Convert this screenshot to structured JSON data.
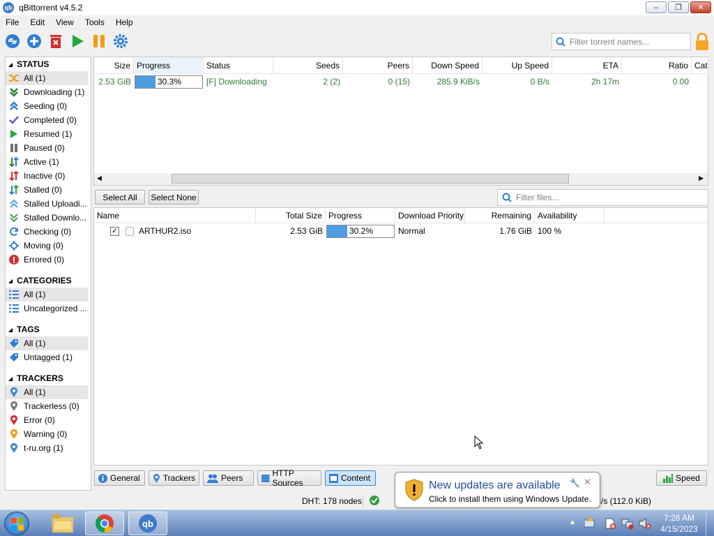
{
  "window": {
    "title": "qBittorrent v4.5.2",
    "app_icon_text": "qb"
  },
  "menu": [
    "File",
    "Edit",
    "View",
    "Tools",
    "Help"
  ],
  "toolbar": {
    "icons": [
      "add-link-icon",
      "add-torrent-icon",
      "delete-icon",
      "resume-icon",
      "pause-icon",
      "options-icon"
    ],
    "filter_placeholder": "Filter torrent names..."
  },
  "sidebar": {
    "status_title": "STATUS",
    "status": [
      {
        "label": "All (1)",
        "icon": "all-icon"
      },
      {
        "label": "Downloading (1)",
        "icon": "downloading-icon"
      },
      {
        "label": "Seeding (0)",
        "icon": "seeding-icon"
      },
      {
        "label": "Completed (0)",
        "icon": "completed-icon"
      },
      {
        "label": "Resumed (1)",
        "icon": "resumed-icon"
      },
      {
        "label": "Paused (0)",
        "icon": "paused-icon"
      },
      {
        "label": "Active (1)",
        "icon": "active-icon"
      },
      {
        "label": "Inactive (0)",
        "icon": "inactive-icon"
      },
      {
        "label": "Stalled (0)",
        "icon": "stalled-icon"
      },
      {
        "label": "Stalled Uploadi...",
        "icon": "stalled-uploading-icon"
      },
      {
        "label": "Stalled Downlo...",
        "icon": "stalled-downloading-icon"
      },
      {
        "label": "Checking (0)",
        "icon": "checking-icon"
      },
      {
        "label": "Moving (0)",
        "icon": "moving-icon"
      },
      {
        "label": "Errored (0)",
        "icon": "errored-icon"
      }
    ],
    "categories_title": "CATEGORIES",
    "categories": [
      {
        "label": "All (1)"
      },
      {
        "label": "Uncategorized ..."
      }
    ],
    "tags_title": "TAGS",
    "tags": [
      {
        "label": "All (1)"
      },
      {
        "label": "Untagged (1)"
      }
    ],
    "trackers_title": "TRACKERS",
    "trackers": [
      {
        "label": "All (1)",
        "color": "#3c8bd4"
      },
      {
        "label": "Trackerless (0)",
        "color": "#7a7a7a"
      },
      {
        "label": "Error (0)",
        "color": "#d32f2f"
      },
      {
        "label": "Warning (0)",
        "color": "#f39c12"
      },
      {
        "label": "t-ru.org (1)",
        "color": "#3c8bd4"
      }
    ]
  },
  "torrent_table": {
    "headers": [
      "Size",
      "Progress",
      "Status",
      "Seeds",
      "Peers",
      "Down Speed",
      "Up Speed",
      "ETA",
      "Ratio",
      "Cat"
    ],
    "rows": [
      {
        "size": "2.53 GiB",
        "progress_text": "30.3%",
        "progress": 0.303,
        "status": "[F] Downloading",
        "seeds": "2 (2)",
        "peers": "0 (15)",
        "down_speed": "285.9 KiB/s",
        "up_speed": "0 B/s",
        "eta": "2h 17m",
        "ratio": "0.00"
      }
    ]
  },
  "content": {
    "select_all": "Select All",
    "select_none": "Select None",
    "filter_placeholder": "Filter files...",
    "headers": [
      "Name",
      "Total Size",
      "Progress",
      "Download Priority",
      "Remaining",
      "Availability"
    ],
    "rows": [
      {
        "name": "ARTHUR2.iso",
        "total_size": "2.53 GiB",
        "progress_text": "30.2%",
        "progress": 0.302,
        "priority": "Normal",
        "remaining": "1.76 GiB",
        "availability": "100 %",
        "checked": true
      }
    ]
  },
  "tabs": [
    {
      "label": "General",
      "icon": "info-icon"
    },
    {
      "label": "Trackers",
      "icon": "tracker-icon"
    },
    {
      "label": "Peers",
      "icon": "peers-icon"
    },
    {
      "label": "HTTP Sources",
      "icon": "server-icon"
    },
    {
      "label": "Content",
      "icon": "content-icon",
      "active": true
    }
  ],
  "speed_button": "Speed",
  "statusbar": {
    "dht": "DHT: 178 nodes",
    "up_speed": "0 B/s (112.0 KiB)"
  },
  "notification": {
    "title": "New updates are available",
    "subtitle": "Click to install them using Windows Update."
  },
  "taskbar": {
    "time": "7:28 AM",
    "date": "4/15/2023"
  }
}
